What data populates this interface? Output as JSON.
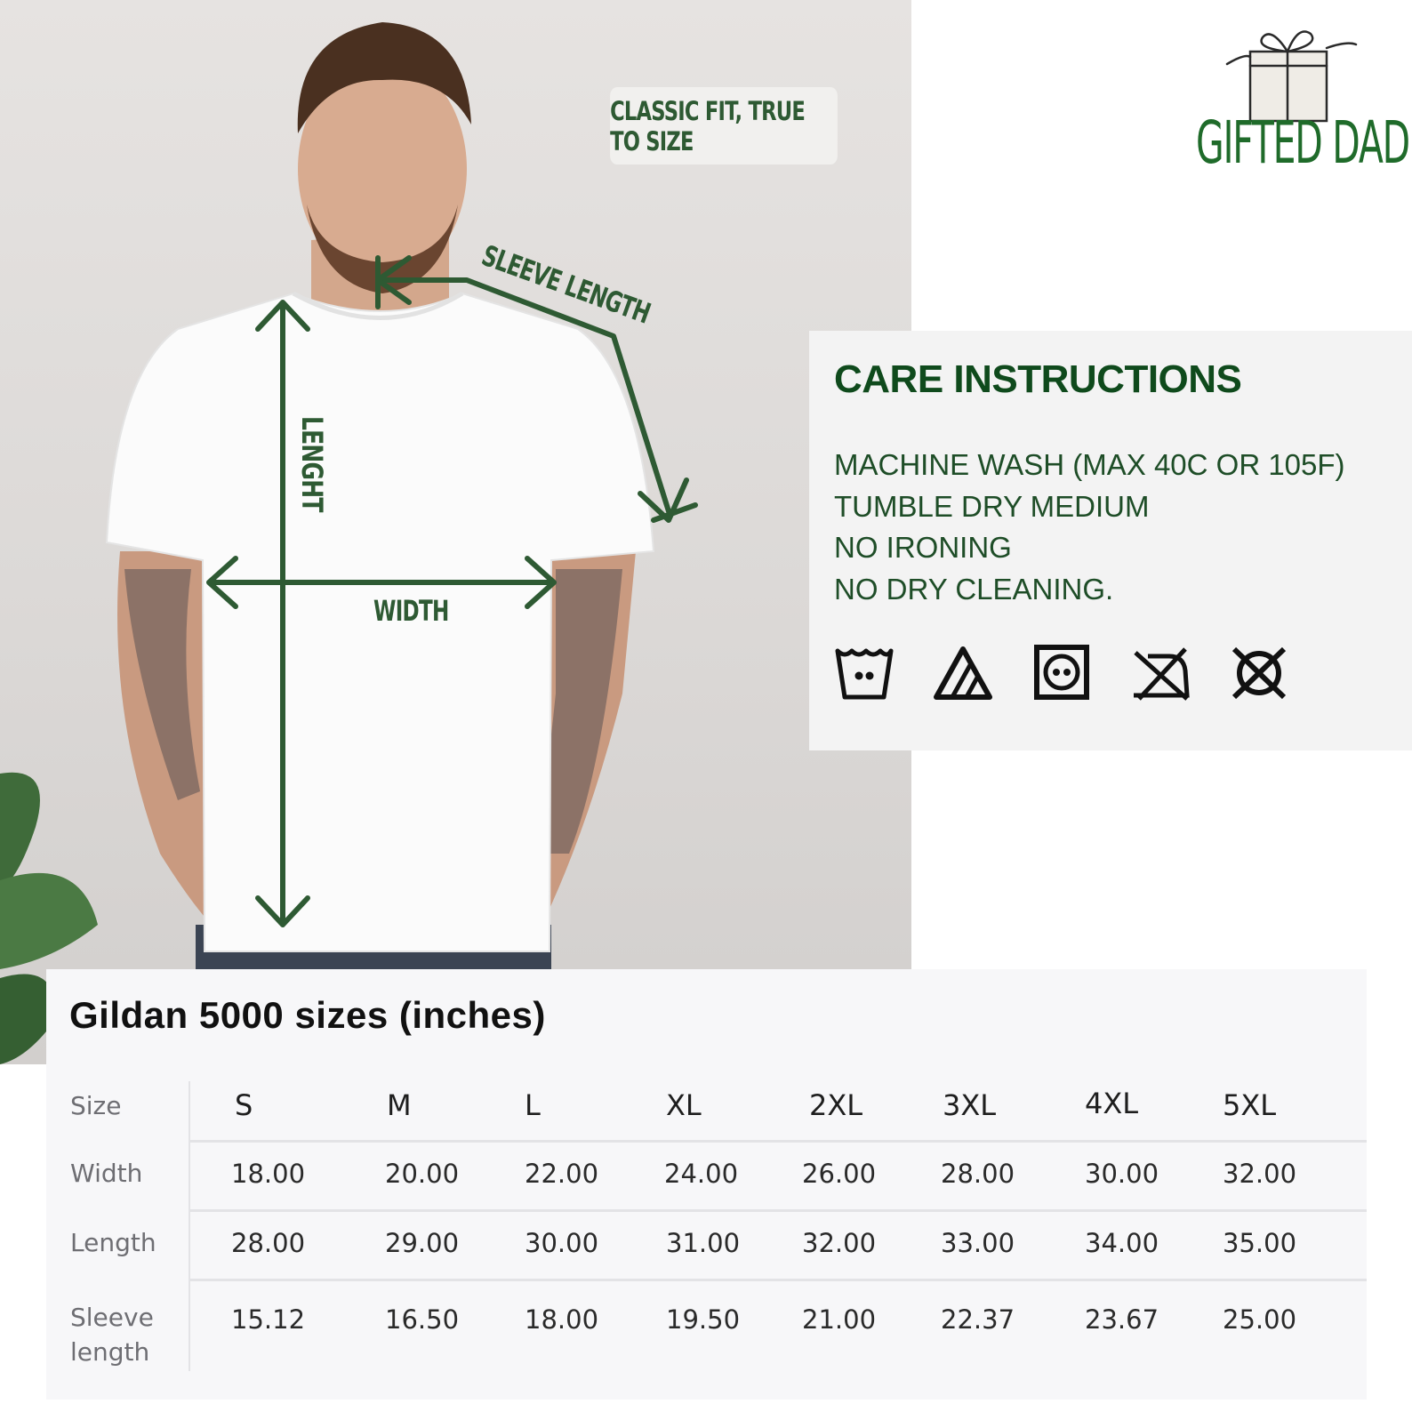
{
  "photo": {
    "fit_badge": "CLASSIC FIT, TRUE TO SIZE",
    "labels": {
      "length": "LENGHT",
      "width": "WIDTH",
      "sleeve": "SLEEVE LENGTH"
    }
  },
  "brand": {
    "name": "GIFTED DAD",
    "color": "#1f6b2a"
  },
  "care": {
    "title": "CARE INSTRUCTIONS",
    "lines": [
      "MACHINE WASH (MAX 40C OR 105F)",
      "TUMBLE DRY MEDIUM",
      "NO IRONING",
      "NO DRY CLEANING."
    ],
    "icons": [
      "wash-40-icon",
      "bleach-allowed-icon",
      "tumble-dry-medium-icon",
      "no-ironing-icon",
      "no-dry-clean-icon"
    ]
  },
  "size_table": {
    "title": "Gildan 5000 sizes (inches)",
    "header_label": "Size",
    "sizes": [
      "S",
      "M",
      "L",
      "XL",
      "2XL",
      "3XL",
      "4XL",
      "5XL"
    ],
    "rows": [
      {
        "label": "Width",
        "values": [
          "18.00",
          "20.00",
          "22.00",
          "24.00",
          "26.00",
          "28.00",
          "30.00",
          "32.00"
        ]
      },
      {
        "label": "Length",
        "values": [
          "28.00",
          "29.00",
          "30.00",
          "31.00",
          "32.00",
          "33.00",
          "34.00",
          "35.00"
        ]
      },
      {
        "label_line1": "Sleeve",
        "label_line2": "length",
        "values": [
          "15.12",
          "16.50",
          "18.00",
          "19.50",
          "21.00",
          "22.37",
          "23.67",
          "25.00"
        ]
      }
    ]
  },
  "colors": {
    "accent_green": "#2e5a33",
    "dark_green": "#0f4a1c"
  }
}
